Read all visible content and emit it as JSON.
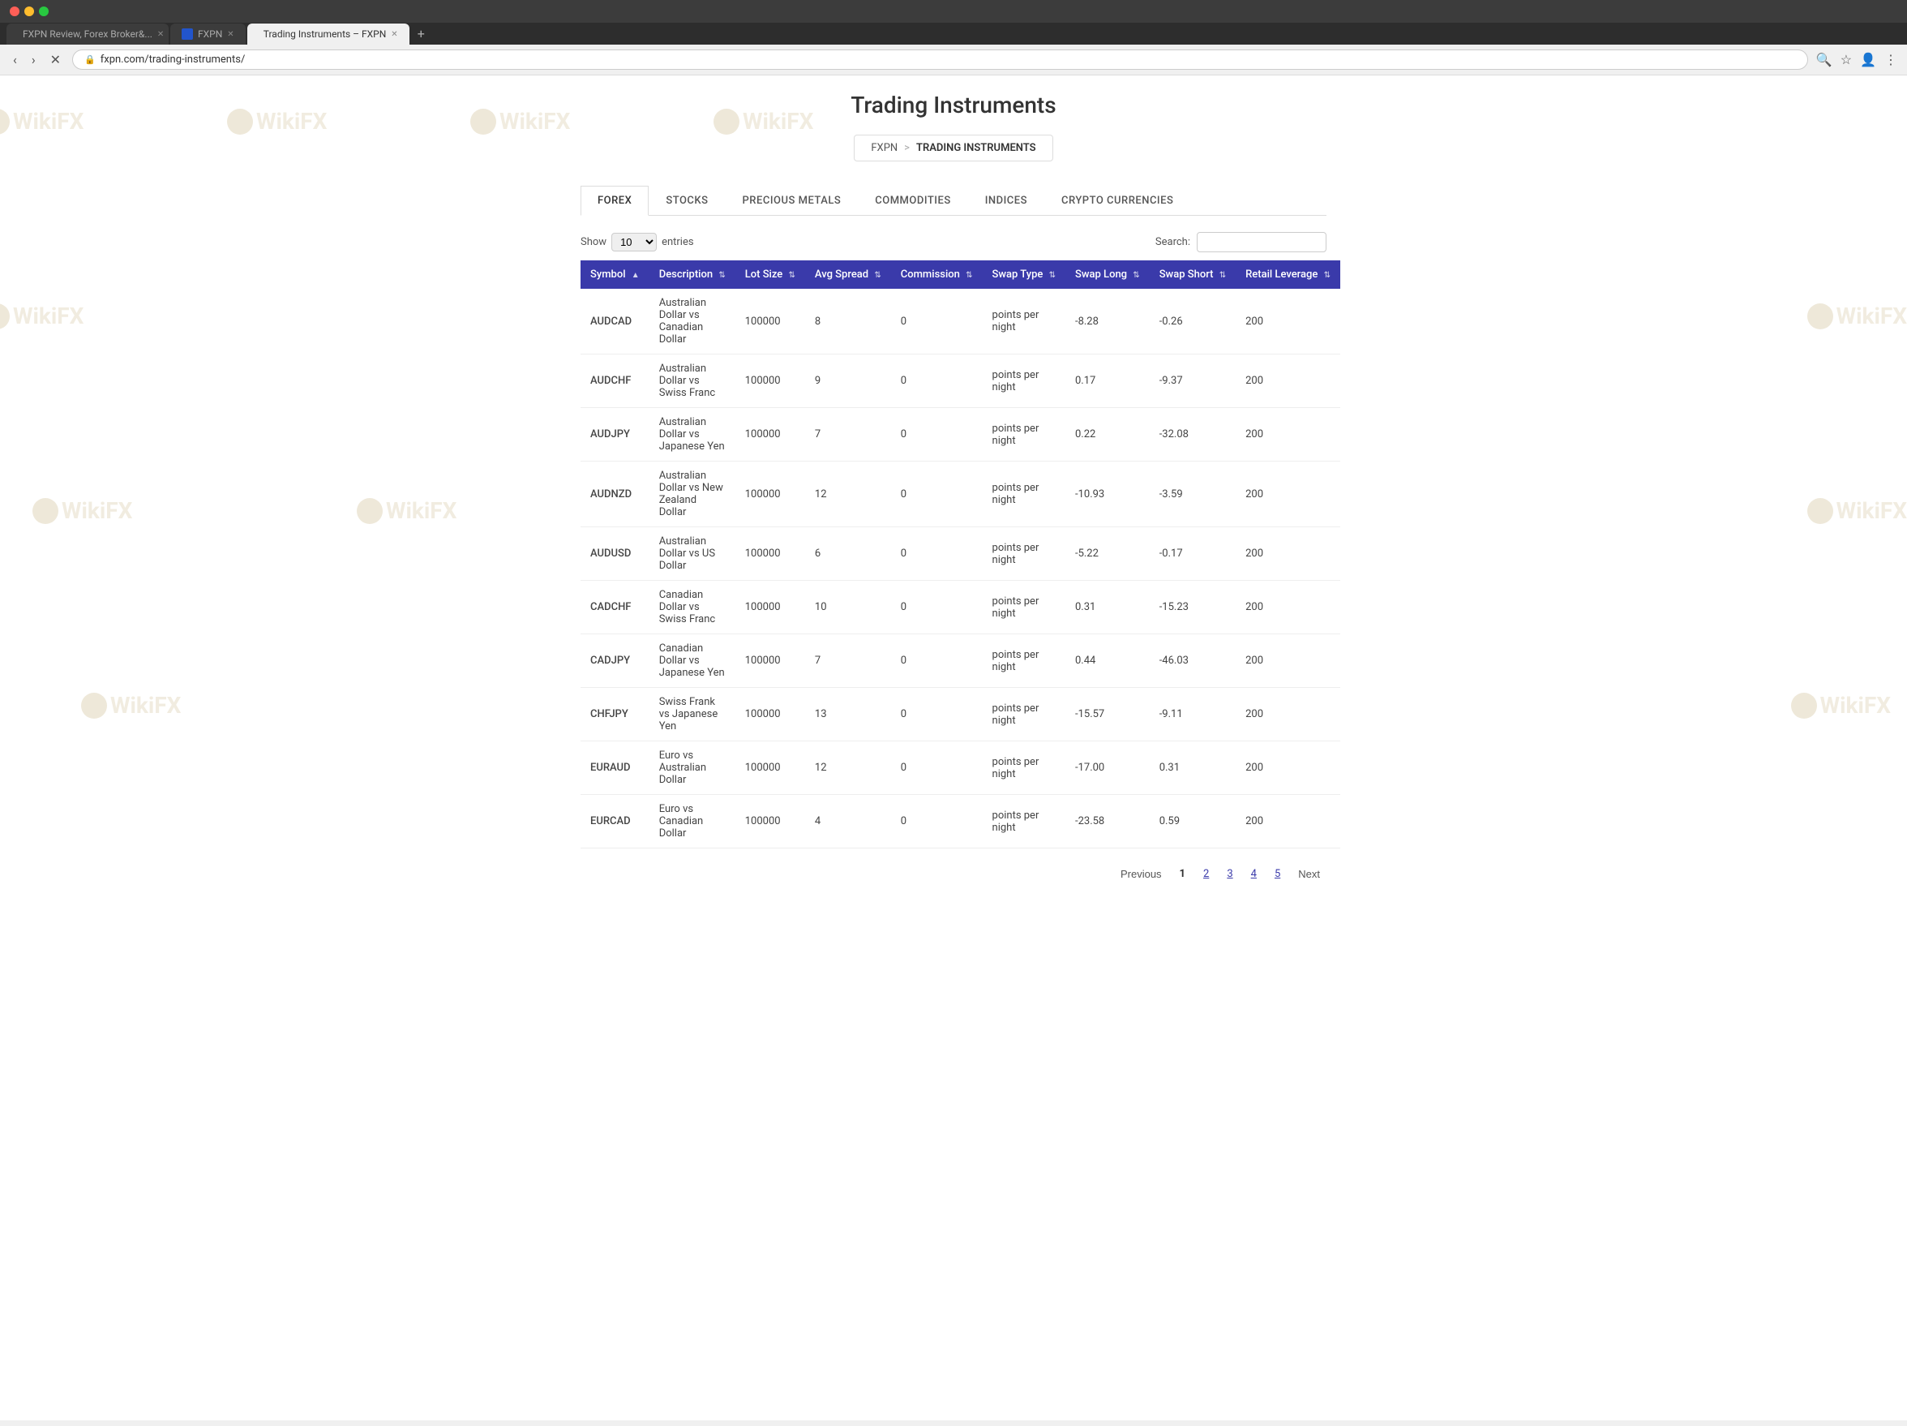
{
  "browser": {
    "tabs": [
      {
        "id": "tab1",
        "label": "FXPN Review, Forex Broker&...",
        "active": false,
        "favicon": "review"
      },
      {
        "id": "tab2",
        "label": "FXPN",
        "active": false,
        "favicon": "fxpn"
      },
      {
        "id": "tab3",
        "label": "Trading Instruments – FXPN",
        "active": true,
        "favicon": "trading"
      }
    ],
    "address": "fxpn.com/trading-instruments/"
  },
  "page": {
    "title": "Trading Instruments",
    "breadcrumb": {
      "home": "FXPN",
      "separator": ">",
      "current": "TRADING INSTRUMENTS"
    }
  },
  "tabs": [
    {
      "id": "forex",
      "label": "FOREX",
      "active": true
    },
    {
      "id": "stocks",
      "label": "STOCKS",
      "active": false
    },
    {
      "id": "precious-metals",
      "label": "PRECIOUS METALS",
      "active": false
    },
    {
      "id": "commodities",
      "label": "COMMODITIES",
      "active": false
    },
    {
      "id": "indices",
      "label": "INDICES",
      "active": false
    },
    {
      "id": "crypto",
      "label": "CRYPTO CURRENCIES",
      "active": false
    }
  ],
  "table": {
    "show_label": "Show",
    "entries_label": "entries",
    "entries_value": "10",
    "search_label": "Search:",
    "search_placeholder": "",
    "columns": [
      {
        "id": "symbol",
        "label": "Symbol",
        "sortable": true,
        "sort_active": true
      },
      {
        "id": "description",
        "label": "Description",
        "sortable": true
      },
      {
        "id": "lot_size",
        "label": "Lot Size",
        "sortable": true
      },
      {
        "id": "avg_spread",
        "label": "Avg Spread",
        "sortable": true
      },
      {
        "id": "commission",
        "label": "Commission",
        "sortable": true
      },
      {
        "id": "swap_type",
        "label": "Swap Type",
        "sortable": true
      },
      {
        "id": "swap_long",
        "label": "Swap Long",
        "sortable": true
      },
      {
        "id": "swap_short",
        "label": "Swap Short",
        "sortable": true
      },
      {
        "id": "retail_leverage",
        "label": "Retail Leverage",
        "sortable": true
      }
    ],
    "rows": [
      {
        "symbol": "AUDCAD",
        "description": "Australian Dollar vs Canadian Dollar",
        "lot_size": "100000",
        "avg_spread": "8",
        "commission": "0",
        "swap_type": "points per night",
        "swap_long": "-8.28",
        "swap_short": "-0.26",
        "retail_leverage": "200"
      },
      {
        "symbol": "AUDCHF",
        "description": "Australian Dollar vs Swiss Franc",
        "lot_size": "100000",
        "avg_spread": "9",
        "commission": "0",
        "swap_type": "points per night",
        "swap_long": "0.17",
        "swap_short": "-9.37",
        "retail_leverage": "200"
      },
      {
        "symbol": "AUDJPY",
        "description": "Australian Dollar vs Japanese Yen",
        "lot_size": "100000",
        "avg_spread": "7",
        "commission": "0",
        "swap_type": "points per night",
        "swap_long": "0.22",
        "swap_short": "-32.08",
        "retail_leverage": "200"
      },
      {
        "symbol": "AUDNZD",
        "description": "Australian Dollar vs New Zealand Dollar",
        "lot_size": "100000",
        "avg_spread": "12",
        "commission": "0",
        "swap_type": "points per night",
        "swap_long": "-10.93",
        "swap_short": "-3.59",
        "retail_leverage": "200"
      },
      {
        "symbol": "AUDUSD",
        "description": "Australian Dollar vs US Dollar",
        "lot_size": "100000",
        "avg_spread": "6",
        "commission": "0",
        "swap_type": "points per night",
        "swap_long": "-5.22",
        "swap_short": "-0.17",
        "retail_leverage": "200"
      },
      {
        "symbol": "CADCHF",
        "description": "Canadian Dollar vs Swiss Franc",
        "lot_size": "100000",
        "avg_spread": "10",
        "commission": "0",
        "swap_type": "points per night",
        "swap_long": "0.31",
        "swap_short": "-15.23",
        "retail_leverage": "200"
      },
      {
        "symbol": "CADJPY",
        "description": "Canadian Dollar vs Japanese Yen",
        "lot_size": "100000",
        "avg_spread": "7",
        "commission": "0",
        "swap_type": "points per night",
        "swap_long": "0.44",
        "swap_short": "-46.03",
        "retail_leverage": "200"
      },
      {
        "symbol": "CHFJPY",
        "description": "Swiss Frank vs Japanese Yen",
        "lot_size": "100000",
        "avg_spread": "13",
        "commission": "0",
        "swap_type": "points per night",
        "swap_long": "-15.57",
        "swap_short": "-9.11",
        "retail_leverage": "200"
      },
      {
        "symbol": "EURAUD",
        "description": "Euro vs Australian Dollar",
        "lot_size": "100000",
        "avg_spread": "12",
        "commission": "0",
        "swap_type": "points per night",
        "swap_long": "-17.00",
        "swap_short": "0.31",
        "retail_leverage": "200"
      },
      {
        "symbol": "EURCAD",
        "description": "Euro vs Canadian Dollar",
        "lot_size": "100000",
        "avg_spread": "4",
        "commission": "0",
        "swap_type": "points per night",
        "swap_long": "-23.58",
        "swap_short": "0.59",
        "retail_leverage": "200"
      }
    ]
  },
  "pagination": {
    "previous_label": "Previous",
    "next_label": "Next",
    "pages": [
      "1",
      "2",
      "3",
      "4",
      "5"
    ],
    "current_page": "1"
  }
}
